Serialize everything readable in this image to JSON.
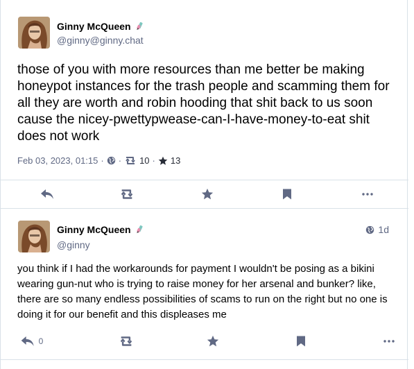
{
  "colors": {
    "icon": "#606984",
    "text": "#000000",
    "muted": "#606984",
    "border": "#d9e1e8"
  },
  "focal_status": {
    "author": {
      "display_name": "Ginny McQueen",
      "handle": "@ginny@ginny.chat",
      "emoji": "pen-icon"
    },
    "content": "those of you with more resources than me better be making honeypot instances for the trash people and scamming them for all they are worth and robin hooding that shit back to us soon cause the nicey-pwettypwease-can-I-have-money-to-eat shit does not work",
    "timestamp": "Feb 03, 2023, 01:15",
    "separator": "·",
    "visibility_icon": "globe-icon",
    "boosts": "10",
    "favourites": "13",
    "actions": [
      "reply-icon",
      "boost-icon",
      "favourite-icon",
      "bookmark-icon",
      "more-icon"
    ]
  },
  "reply_status": {
    "author": {
      "display_name": "Ginny McQueen",
      "handle": "@ginny",
      "emoji": "pen-icon"
    },
    "relative_time": "1d",
    "visibility_icon": "globe-icon",
    "content": "you think if I had the workarounds for payment I wouldn't be posing as a bikini wearing gun-nut who is trying to raise money for her arsenal and bunker? like, there are so many endless possibilities of scams to run on the right but no one is doing it for our benefit and this displeases me",
    "reply_count": "0",
    "actions": [
      "reply-icon",
      "boost-icon",
      "favourite-icon",
      "bookmark-icon",
      "more-icon"
    ]
  }
}
